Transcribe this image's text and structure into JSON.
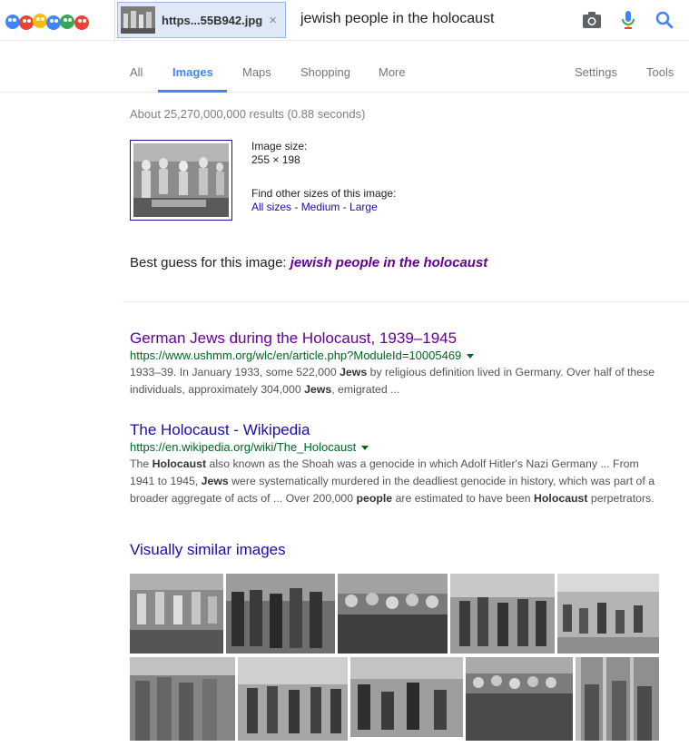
{
  "header": {
    "chip_label": "https...55B942.jpg",
    "chip_close": "×",
    "query": "jewish people in the holocaust",
    "icons": [
      "camera-icon",
      "microphone-icon",
      "search-icon"
    ]
  },
  "tabs": [
    {
      "label": "All",
      "active": false
    },
    {
      "label": "Images",
      "active": true
    },
    {
      "label": "Maps",
      "active": false
    },
    {
      "label": "Shopping",
      "active": false
    },
    {
      "label": "More",
      "active": false
    },
    {
      "label": "Settings",
      "active": false
    },
    {
      "label": "Tools",
      "active": false
    }
  ],
  "stats": "About 25,270,000,000 results (0.88 seconds)",
  "image_info": {
    "size_label": "Image size:",
    "size_value": "255 × 198",
    "find_label": "Find other sizes of this image:",
    "all_sizes": "All sizes",
    "medium": "Medium",
    "large": "Large",
    "sep": " - "
  },
  "best_guess": {
    "label": "Best guess for this image:",
    "query": "jewish people in the holocaust"
  },
  "results": [
    {
      "title": "German Jews during the Holocaust, 1939–1945",
      "url": "https://www.ushmm.org/wlc/en/article.php?ModuleId=10005469",
      "snippet_1": "1933–39. In January 1933, some 522,000 <b>Jews</b> by religious definition lived in Germany. Over half of these",
      "snippet_2": "individuals, approximately 304,000 <b>Jews</b>, emigrated ..."
    },
    {
      "title": "The Holocaust - Wikipedia",
      "url": "https://en.wikipedia.org/wiki/The_Holocaust",
      "snippet_1": "The <b>Holocaust</b> also known as the Shoah was a genocide in which Adolf Hitler's Nazi Germany ... From",
      "snippet_2": "1941 to 1945, <b>Jews</b> were systematically murdered in the deadliest genocide in history, which was part of a",
      "snippet_3": "broader aggregate of acts of ... Over 200,000 <b>people</b> are estimated to have been <b>Holocaust</b> perpetrators."
    }
  ],
  "visually_similar": {
    "title": "Visually similar images"
  },
  "colors": {
    "accent": "#4285f4",
    "link": "#1a0dab",
    "visited": "#660099",
    "url_green": "#006621"
  }
}
